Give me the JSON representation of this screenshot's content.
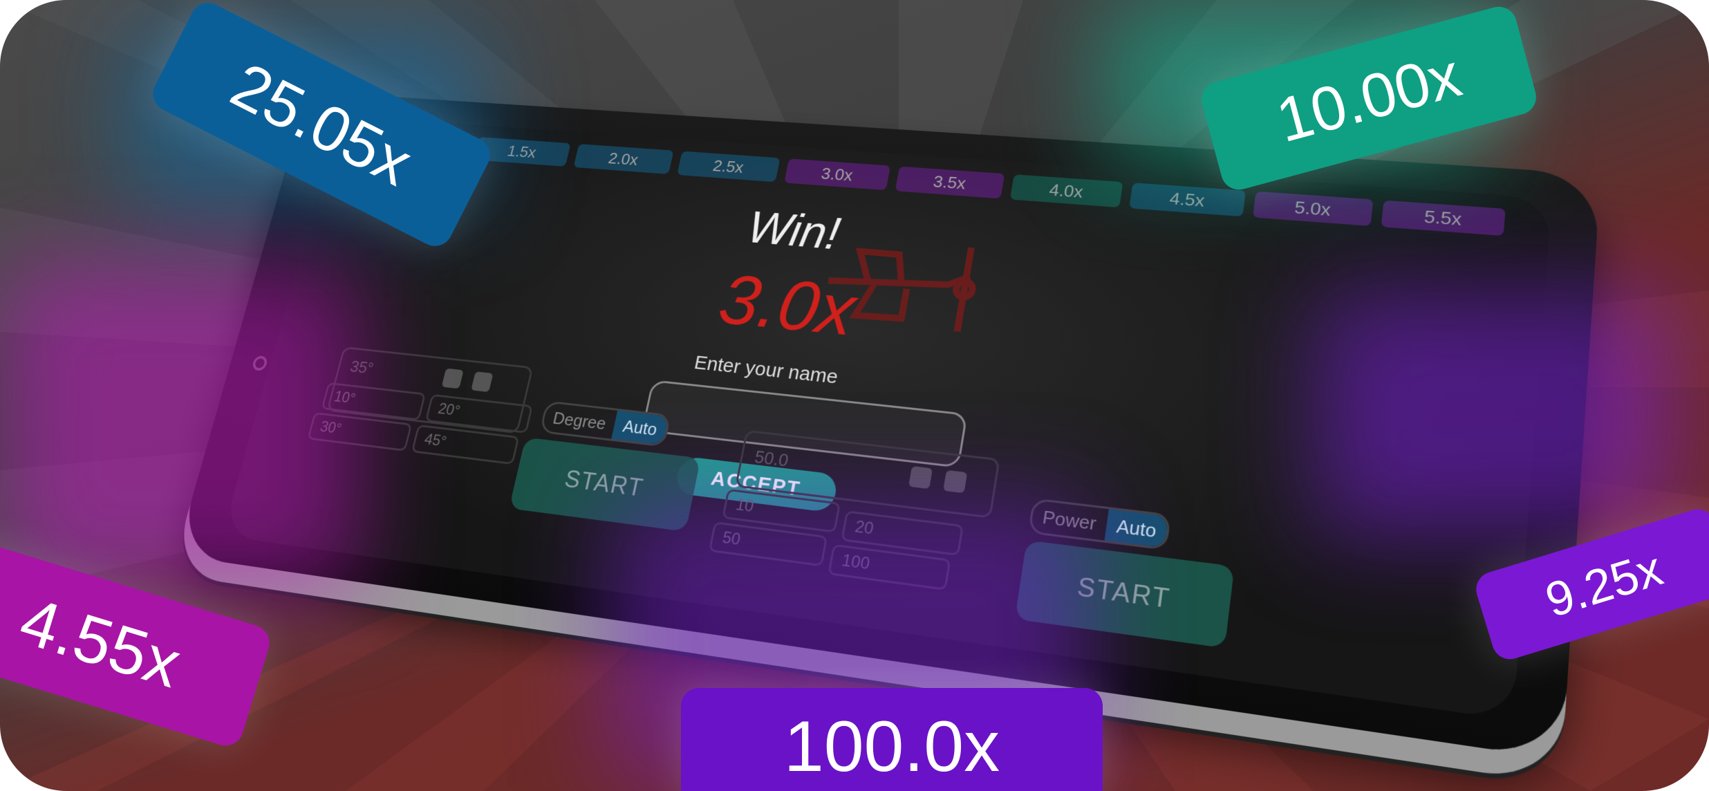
{
  "colors": {
    "badge_blue": "#0b5f99",
    "badge_green": "#0f9f83",
    "badge_magenta": "#a814a6",
    "badge_purple": "#6a12c8",
    "badge_violet": "#7b18d4",
    "win_red": "#d0201c",
    "accept_teal": "#1e9e8a"
  },
  "multiplier_strip": [
    {
      "label": "1.5x",
      "color": "#16506f"
    },
    {
      "label": "2.0x",
      "color": "#16506f"
    },
    {
      "label": "2.5x",
      "color": "#16506f"
    },
    {
      "label": "3.0x",
      "color": "#5b1f7a"
    },
    {
      "label": "3.5x",
      "color": "#5b1f7a"
    },
    {
      "label": "4.0x",
      "color": "#165a4f"
    },
    {
      "label": "4.5x",
      "color": "#16506f"
    },
    {
      "label": "5.0x",
      "color": "#5b1f7a"
    },
    {
      "label": "5.5x",
      "color": "#5b1f7a"
    }
  ],
  "win_dialog": {
    "title": "Win!",
    "multiplier": "3.0x",
    "name_label": "Enter your name",
    "name_value": "",
    "accept_label": "ACCEPT"
  },
  "left_panel": {
    "angle_value": "35°",
    "presets": [
      "10°",
      "20°",
      "30°",
      "45°"
    ],
    "mode_label": "Degree",
    "mode_active": "Auto",
    "start_label": "START"
  },
  "right_panel": {
    "power_value": "50.0",
    "presets": [
      "10",
      "20",
      "50",
      "100"
    ],
    "mode_label": "Power",
    "mode_active": "Auto",
    "start_label": "START"
  },
  "badges": {
    "top_left": "25.05x",
    "top_right": "10.00x",
    "left": "4.55x",
    "right": "9.25x",
    "bottom": "100.0x"
  }
}
